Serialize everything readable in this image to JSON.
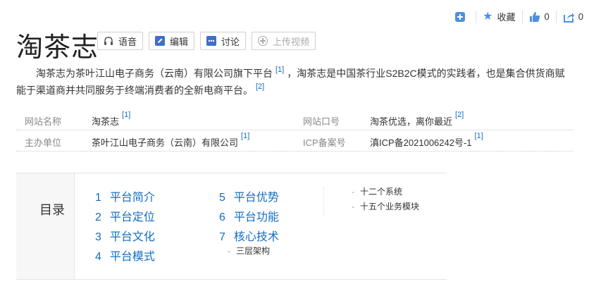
{
  "topbar": {
    "favorite_label": "收藏",
    "like_count": "0",
    "share_count": "0"
  },
  "title": "淘茶志",
  "tools": {
    "voice": "语音",
    "edit": "编辑",
    "discuss": "讨论",
    "upload_video": "上传视频"
  },
  "summary": {
    "part1": "淘茶志为茶叶江山电子商务（云南）有限公司旗下平台",
    "ref1": "[1]",
    "part2": "，淘茶志是中国茶行业S2B2C模式的实践者，也是集合供货商赋能于渠道商并共同服务于终端消费者的全新电商平台。",
    "ref2": "[2]"
  },
  "basic_info": {
    "row1": {
      "label1": "网站名称",
      "value1": "淘茶志",
      "ref1": "[1]",
      "label2": "网站口号",
      "value2": "淘茶优选，离你最近",
      "ref2": "[2]"
    },
    "row2": {
      "label1": "主办单位",
      "value1": "茶叶江山电子商务（云南）有限公司",
      "ref1": "[1]",
      "label2": "ICP备案号",
      "value2": "滇ICP备2021006242号-1",
      "ref2": "[1]"
    }
  },
  "catalog": {
    "heading": "目录",
    "items": [
      {
        "num": "1",
        "label": "平台简介"
      },
      {
        "num": "2",
        "label": "平台定位"
      },
      {
        "num": "3",
        "label": "平台文化"
      },
      {
        "num": "4",
        "label": "平台模式"
      },
      {
        "num": "5",
        "label": "平台优势"
      },
      {
        "num": "6",
        "label": "平台功能"
      },
      {
        "num": "7",
        "label": "核心技术"
      }
    ],
    "subitems": {
      "item7_sub1": "三层架构",
      "col3_sub1": "十二个系统",
      "col3_sub2": "十五个业务模块"
    }
  }
}
